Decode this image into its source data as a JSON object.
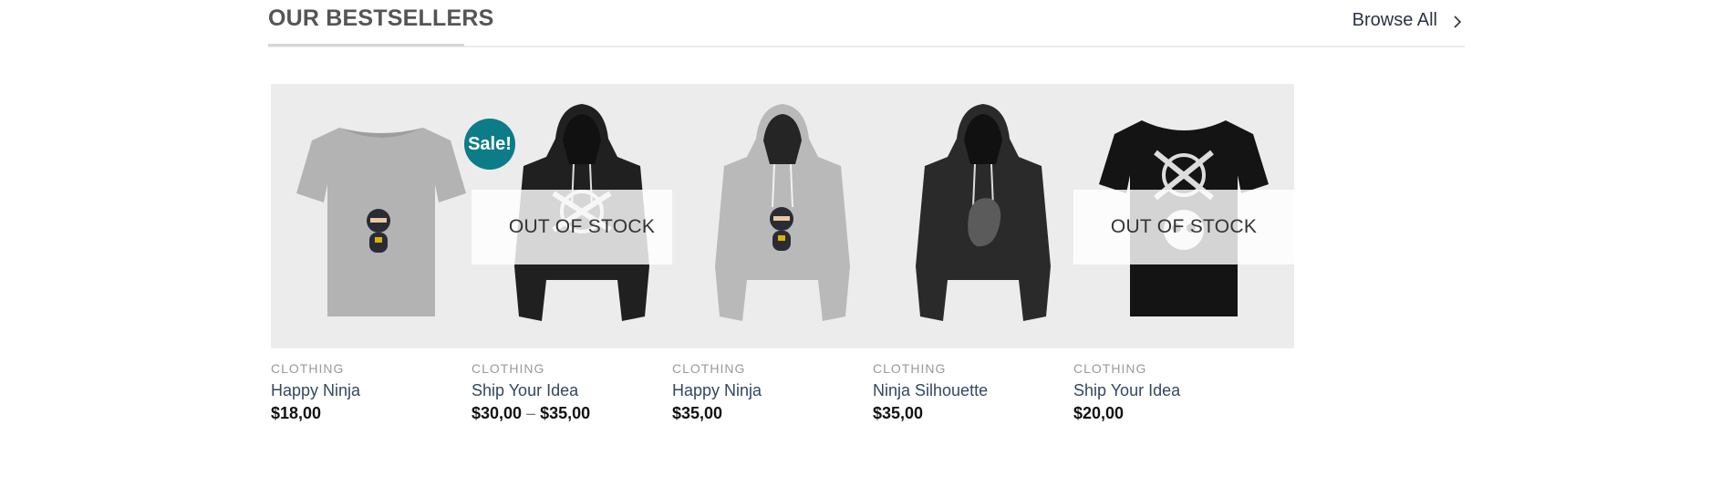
{
  "section": {
    "title": "OUR BESTSELLERS",
    "browse_all": "Browse All",
    "browse_icon": "chevron-right-icon"
  },
  "products": [
    {
      "category": "CLOTHING",
      "name": "Happy Ninja",
      "price": "$18,00",
      "image": "grey-ninja-tshirt",
      "badge": "",
      "stock": ""
    },
    {
      "category": "CLOTHING",
      "name": "Ship Your Idea",
      "price_low": "$30,00",
      "price_sep": "–",
      "price_high": "$35,00",
      "image": "black-ship-your-idea-hoodie",
      "badge": "Sale!",
      "stock": "OUT OF STOCK"
    },
    {
      "category": "CLOTHING",
      "name": "Happy Ninja",
      "price": "$35,00",
      "image": "grey-ninja-hoodie",
      "badge": "",
      "stock": ""
    },
    {
      "category": "CLOTHING",
      "name": "Ninja Silhouette",
      "price": "$35,00",
      "image": "black-ninja-silhouette-hoodie",
      "badge": "",
      "stock": ""
    },
    {
      "category": "CLOTHING",
      "name": "Ship Your Idea",
      "price": "$20,00",
      "image": "black-ship-your-idea-tshirt",
      "badge": "",
      "stock": "OUT OF STOCK"
    }
  ],
  "colors": {
    "sale_badge": "#0c7c89",
    "product_link": "#334862",
    "image_bg": "#ececec"
  }
}
